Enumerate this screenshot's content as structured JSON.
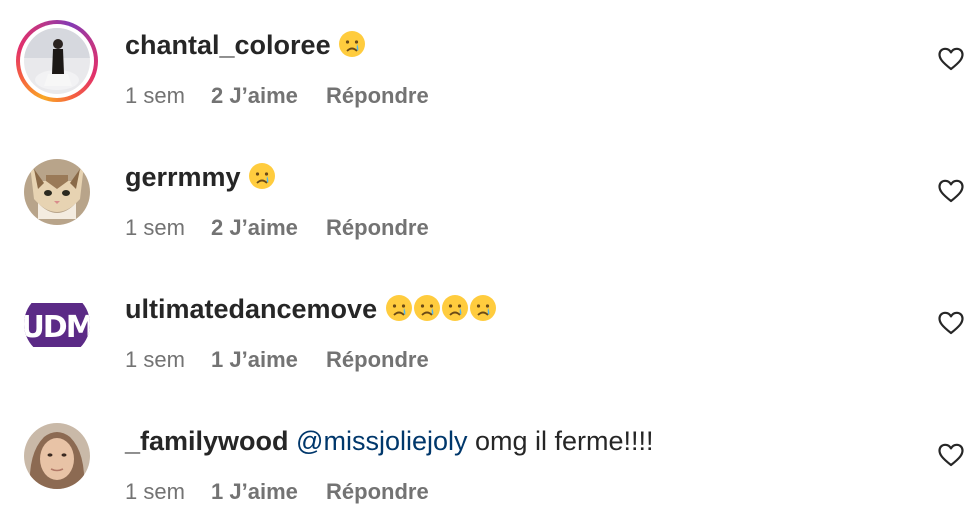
{
  "comments": [
    {
      "username": "chantal_coloree",
      "mention": "",
      "text": "",
      "emojis": [
        "crying-face"
      ],
      "time": "1 sem",
      "likes": "2 J’aime",
      "reply": "Répondre",
      "has_story_ring": true
    },
    {
      "username": "gerrmmy",
      "mention": "",
      "text": "",
      "emojis": [
        "crying-face"
      ],
      "time": "1 sem",
      "likes": "2 J’aime",
      "reply": "Répondre",
      "has_story_ring": false
    },
    {
      "username": "ultimatedancemove",
      "mention": "",
      "text": "",
      "emojis": [
        "crying-face",
        "crying-face",
        "crying-face",
        "crying-face"
      ],
      "time": "1 sem",
      "likes": "1 J’aime",
      "reply": "Répondre",
      "has_story_ring": false,
      "avatar_logo": "UDM"
    },
    {
      "username": "_familywood",
      "mention": "@missjoliejoly",
      "text": "omg il ferme!!!!",
      "emojis": [],
      "time": "1 sem",
      "likes": "1 J’aime",
      "reply": "Répondre",
      "has_story_ring": false
    }
  ],
  "colors": {
    "username": "#262626",
    "meta": "#737373",
    "mention": "#00376b",
    "udm_purple": "#5b2a86"
  },
  "icons": {
    "like": "heart-outline-icon",
    "emoji": "crying-face-emoji"
  }
}
